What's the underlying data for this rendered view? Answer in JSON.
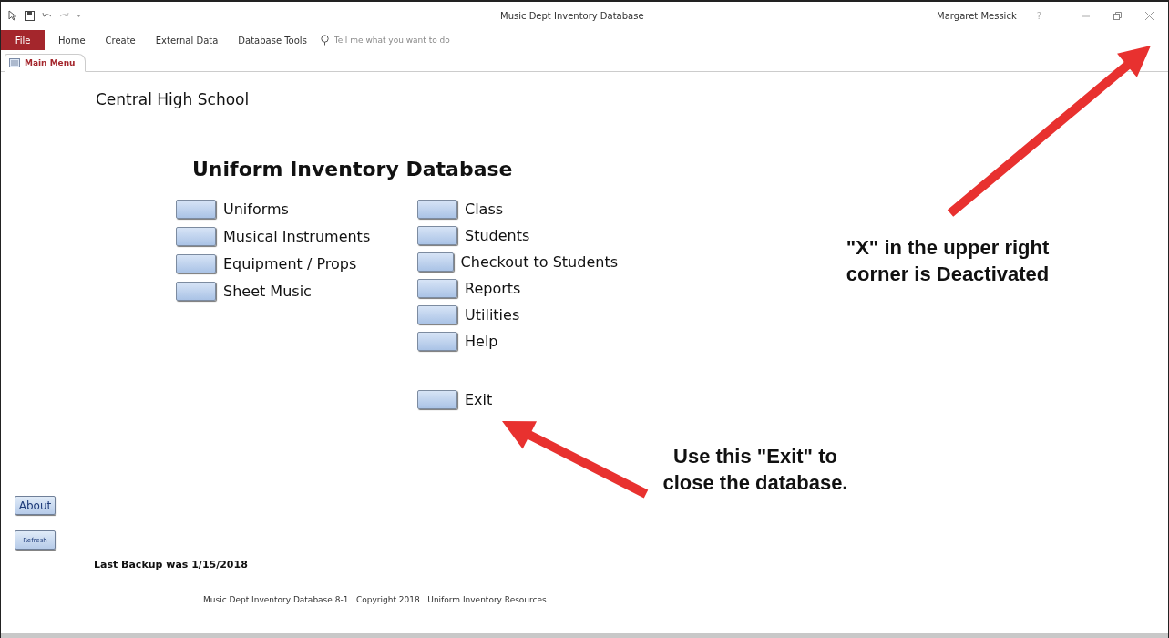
{
  "window": {
    "title": "Music Dept Inventory Database",
    "user": "Margaret Messick",
    "help": "?"
  },
  "ribbon": {
    "tabs": [
      {
        "label": "File",
        "kind": "file"
      },
      {
        "label": "Home",
        "kind": "tab"
      },
      {
        "label": "Create",
        "kind": "tab"
      },
      {
        "label": "External Data",
        "kind": "tab"
      },
      {
        "label": "Database Tools",
        "kind": "tab"
      }
    ],
    "search": {
      "placeholder": "Tell me what you want to do"
    }
  },
  "document_tabs": [
    {
      "label": "Main Menu",
      "selected": true
    }
  ],
  "form": {
    "school": "Central High School",
    "heading": "Uniform Inventory Database",
    "menu_left": [
      "Uniforms",
      "Musical Instruments",
      "Equipment / Props",
      "Sheet Music"
    ],
    "menu_right": [
      "Class",
      "Students",
      "Checkout to Students",
      "Reports",
      "Utilities",
      "Help"
    ],
    "exit": "Exit",
    "side_buttons": [
      "About",
      "Refresh"
    ],
    "last_backup": "Last Backup was 1/15/2018",
    "footer": "Music Dept Inventory Database 8-1   Copyright 2018   Uniform Inventory Resources"
  },
  "annotations": [
    {
      "text": "\"X\" in the upper right corner is Deactivated"
    },
    {
      "text": "Use this \"Exit\" to close the database."
    }
  ]
}
